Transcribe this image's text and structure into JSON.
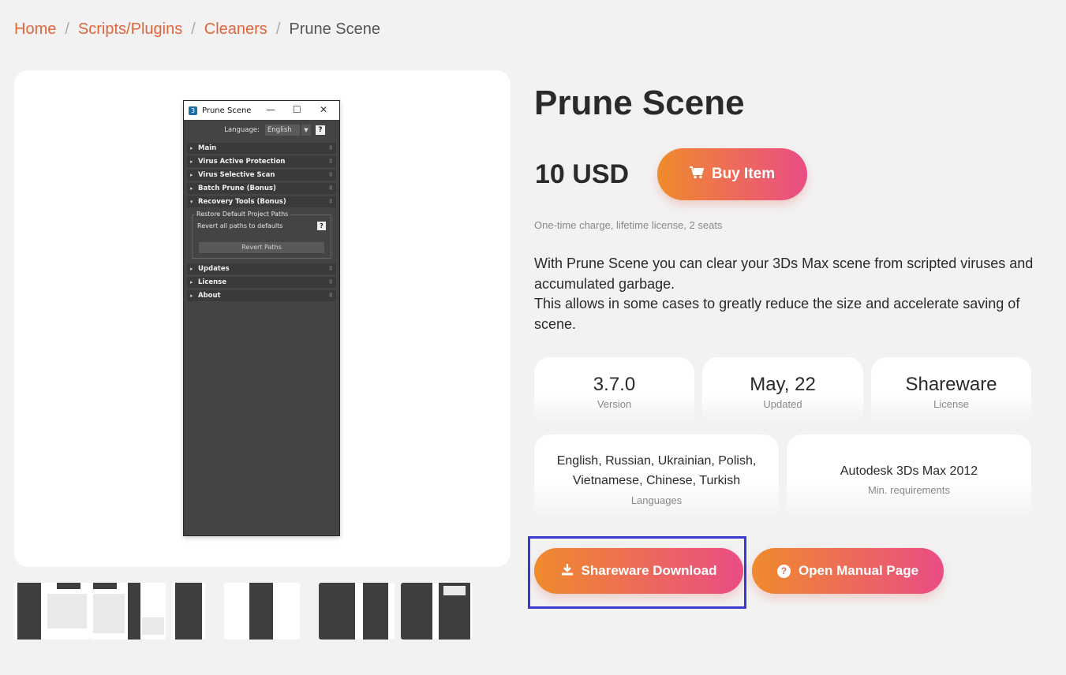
{
  "breadcrumb": {
    "items": [
      "Home",
      "Scripts/Plugins",
      "Cleaners"
    ],
    "separator": "/",
    "current": "Prune Scene"
  },
  "preview": {
    "window_title": "Prune Scene",
    "app_icon_text": "3",
    "controls": [
      "—",
      "☐",
      "✕"
    ],
    "language_label": "Language:",
    "language_value": "English",
    "help": "?",
    "rollouts_top": [
      "Main",
      "Virus Active Protection",
      "Virus Selective Scan",
      "Batch Prune (Bonus)",
      "Recovery Tools (Bonus)"
    ],
    "group_legend": "Restore Default Project Paths",
    "group_text": "Revert all paths to defaults",
    "revert_button": "Revert Paths",
    "rollouts_bottom": [
      "Updates",
      "License",
      "About"
    ]
  },
  "product": {
    "title": "Prune Scene",
    "price": "10 USD",
    "buy_label": "Buy Item",
    "note": "One-time charge, lifetime license, 2 seats",
    "description_1": "With Prune Scene you can clear your 3Ds Max scene from scripted viruses and accumulated garbage.",
    "description_2": "This allows in some cases to greatly reduce the size and accelerate saving of scene."
  },
  "stats": {
    "version": {
      "value": "3.7.0",
      "label": "Version"
    },
    "updated": {
      "value": "May, 22",
      "label": "Updated"
    },
    "license": {
      "value": "Shareware",
      "label": "License"
    },
    "languages": {
      "value": "English, Russian, Ukrainian, Polish, Vietnamese, Chinese, Turkish",
      "label": "Languages"
    },
    "requirements": {
      "value": "Autodesk 3Ds Max 2012",
      "label": "Min. requirements"
    }
  },
  "actions": {
    "download_label": "Shareware Download",
    "manual_label": "Open Manual Page"
  },
  "icons": {
    "cart": "cart-icon",
    "download": "download-icon",
    "help": "question-circle-icon"
  },
  "colors": {
    "accent": "#e2643c",
    "gradient_start": "#ef8b2c",
    "gradient_end": "#ea4c85",
    "highlight_box": "#3a3ad0"
  }
}
